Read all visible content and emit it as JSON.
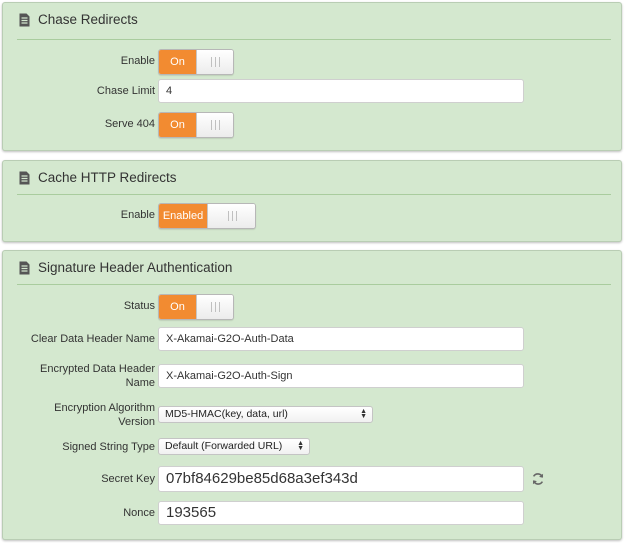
{
  "chase_redirects": {
    "title": "Chase Redirects",
    "enable_label": "Enable",
    "enable_value": "On",
    "chase_limit_label": "Chase Limit",
    "chase_limit_value": "4",
    "serve404_label": "Serve 404",
    "serve404_value": "On"
  },
  "cache_http_redirects": {
    "title": "Cache HTTP Redirects",
    "enable_label": "Enable",
    "enable_value": "Enabled"
  },
  "signature_auth": {
    "title": "Signature Header Authentication",
    "status_label": "Status",
    "status_value": "On",
    "clear_header_label": "Clear Data Header Name",
    "clear_header_value": "X-Akamai-G2O-Auth-Data",
    "encrypted_header_label": "Encrypted Data Header Name",
    "encrypted_header_value": "X-Akamai-G2O-Auth-Sign",
    "algorithm_label": "Encryption Algorithm Version",
    "algorithm_value": "MD5-HMAC(key, data, url)",
    "signed_string_label": "Signed String Type",
    "signed_string_value": "Default (Forwarded URL)",
    "secret_key_label": "Secret Key",
    "secret_key_value": "07bf84629be85d68a3ef343d",
    "nonce_label": "Nonce",
    "nonce_value": "193565"
  },
  "colors": {
    "panel_bg": "#d4e8cf",
    "toggle_on": "#f28b31",
    "divider": "#a9cc9e"
  },
  "icons": {
    "panel_header": "document-icon",
    "regenerate": "refresh-icon"
  }
}
